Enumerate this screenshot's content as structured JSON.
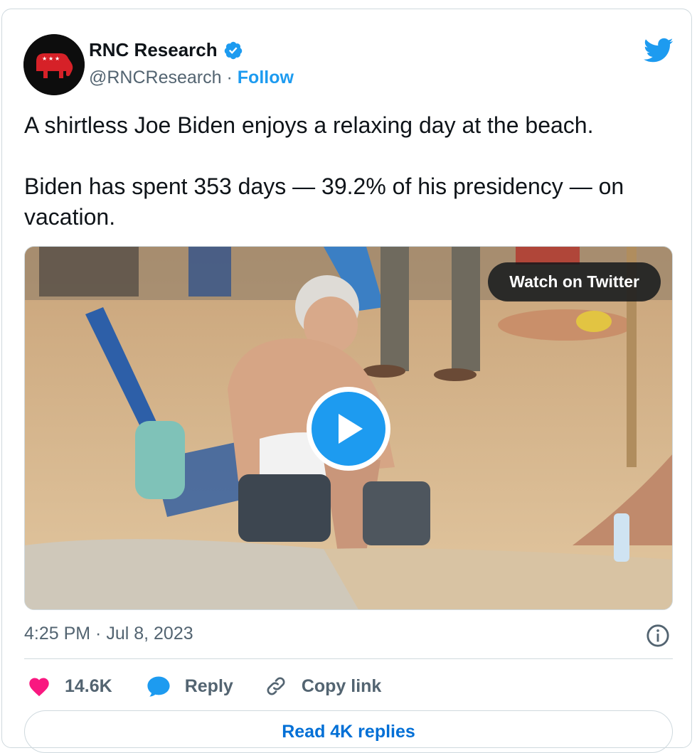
{
  "author": {
    "name": "RNC Research",
    "handle": "@RNCResearch",
    "separator": "·",
    "follow_label": "Follow"
  },
  "tweet": {
    "lines": [
      "A shirtless Joe Biden enjoys a relaxing day at the beach.",
      "Biden has spent 353 days — 39.2% of his presidency — on vacation."
    ]
  },
  "media": {
    "watch_label": "Watch on Twitter"
  },
  "meta": {
    "timestamp": "4:25 PM · Jul 8, 2023"
  },
  "actions": {
    "likes": "14.6K",
    "reply_label": "Reply",
    "copy_link_label": "Copy link"
  },
  "read_replies_label": "Read 4K replies",
  "icons": [
    "rnc-elephant-logo",
    "verified-badge-icon",
    "twitter-bird-icon",
    "play-icon",
    "info-icon",
    "heart-icon",
    "reply-bubble-icon",
    "link-icon"
  ],
  "colors": {
    "accent": "#1d9bf0",
    "link_blue": "#006fd6",
    "heart": "#f91880",
    "muted": "#536471",
    "rnc_red": "#d62128"
  }
}
